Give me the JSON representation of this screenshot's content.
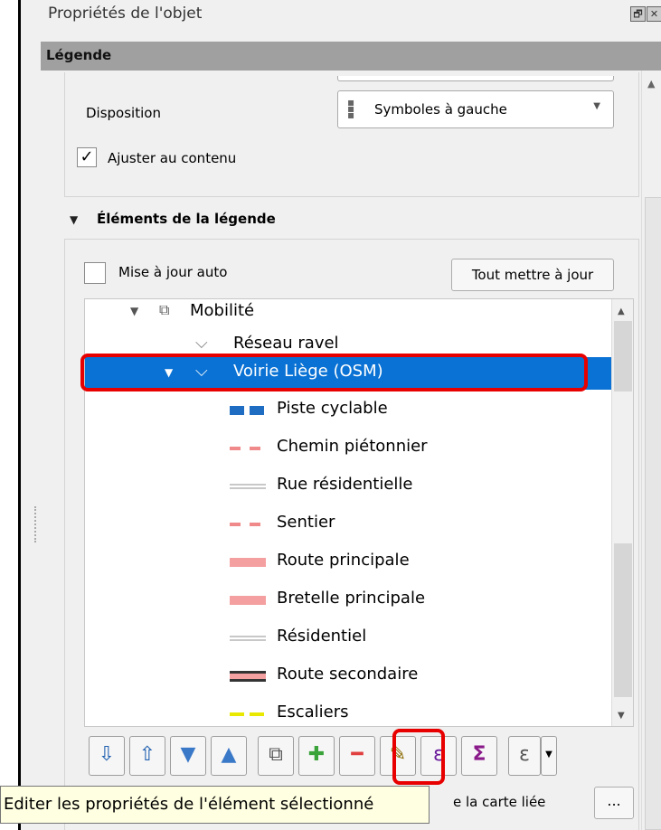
{
  "panel": {
    "title": "Propriétés de l'objet",
    "title_icons": [
      "🗗",
      "✕"
    ]
  },
  "legend_section": {
    "header": "Légende"
  },
  "layout_group": {
    "disposition_label": "Disposition",
    "disposition_value": "Symboles à gauche",
    "resize_checkbox_label": "Ajuster au contenu",
    "resize_checked": true
  },
  "items_group": {
    "header": "Éléments de la légende",
    "auto_update_label": "Mise à jour auto",
    "auto_update_checked": false,
    "update_all_button": "Tout mettre à jour"
  },
  "tree": {
    "group": {
      "label": "Mobilité",
      "icon": "layer-group-icon"
    },
    "layers": [
      {
        "label": "Réseau ravel",
        "icon": "line-layer-icon",
        "selected": false
      },
      {
        "label": "Voirie Liège (OSM)",
        "icon": "line-layer-icon",
        "selected": true
      }
    ],
    "classes": [
      {
        "label": "Piste cyclable",
        "color": "#1f6dc2",
        "style": "dash-thick"
      },
      {
        "label": "Chemin piétonnier",
        "color": "#f08a8a",
        "style": "dash-thin"
      },
      {
        "label": "Rue résidentielle",
        "color": "#c8c8c8",
        "style": "double-thin"
      },
      {
        "label": "Sentier",
        "color": "#f08a8a",
        "style": "dash-thin"
      },
      {
        "label": "Route principale",
        "color": "#f4a0a0",
        "style": "solid-thick"
      },
      {
        "label": "Bretelle principale",
        "color": "#f4a0a0",
        "style": "solid-thick"
      },
      {
        "label": "Résidentiel",
        "color": "#c8c8c8",
        "style": "double-thin"
      },
      {
        "label": "Route secondaire",
        "color": "#f4a0a0",
        "style": "cased"
      },
      {
        "label": "Escaliers",
        "color": "#e8e800",
        "style": "dash-thick"
      }
    ]
  },
  "toolbar": {
    "buttons": [
      {
        "name": "move-down-button",
        "icon": "⇩",
        "color": "#2060b0"
      },
      {
        "name": "move-up-button",
        "icon": "⇧",
        "color": "#2060b0"
      },
      {
        "name": "expand-button",
        "icon": "▼",
        "color": "#3a78c8"
      },
      {
        "name": "collapse-button",
        "icon": "▲",
        "color": "#3a78c8"
      },
      {
        "name": "add-group-button",
        "icon": "⧉",
        "color": "#555555"
      },
      {
        "name": "add-item-button",
        "icon": "✚",
        "color": "#3aa33a"
      },
      {
        "name": "remove-item-button",
        "icon": "━",
        "color": "#e04040"
      },
      {
        "name": "edit-item-button",
        "icon": "✎",
        "color": "#8a6a00"
      },
      {
        "name": "expression-button",
        "icon": "ε",
        "color": "#6a1a9a"
      },
      {
        "name": "count-button",
        "icon": "Σ",
        "color": "#8a1a8a"
      },
      {
        "name": "filter-expression-button",
        "icon": "ε",
        "color": "#555555"
      }
    ]
  },
  "tooltip": {
    "text": "Editer les propriétés de l'élément sélectionné"
  },
  "linked_map": {
    "label_partial": "e la carte liée",
    "browse_button": "..."
  }
}
